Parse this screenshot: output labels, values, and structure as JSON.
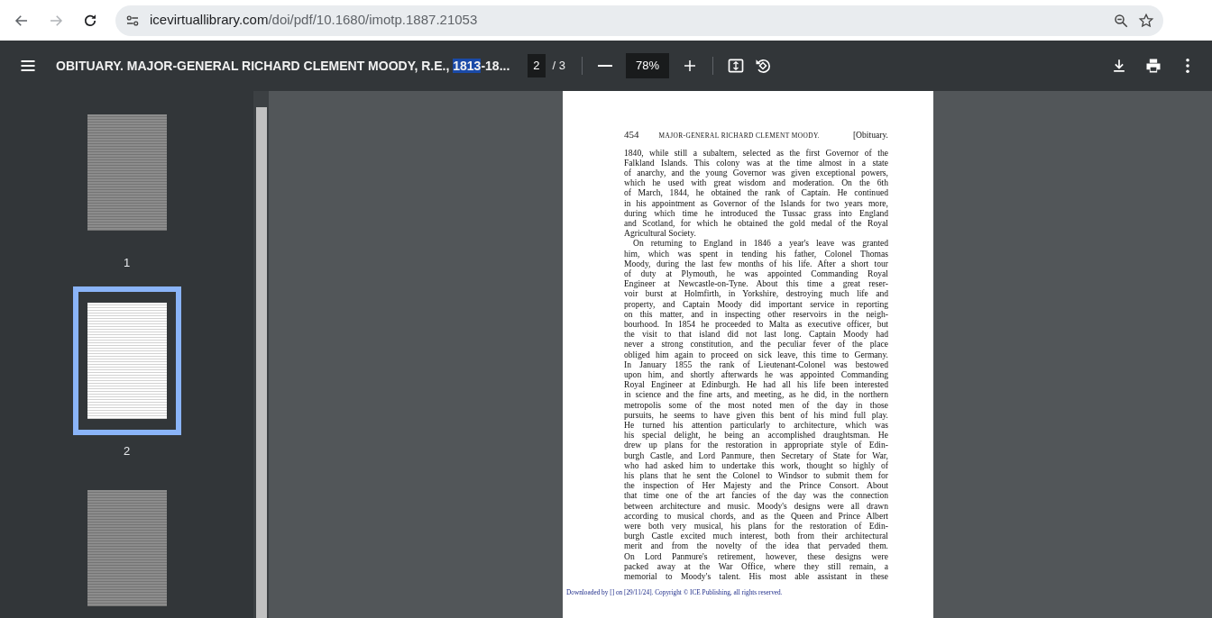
{
  "browser": {
    "back_disabled": false,
    "forward_disabled": true,
    "url_host": "icevirtuallibrary.com",
    "url_path": "/doi/pdf/10.1680/imotp.1887.21053"
  },
  "toolbar": {
    "title_before": "OBITUARY. MAJOR-GENERAL RICHARD CLEMENT MOODY, R.E., ",
    "title_highlight": "1813",
    "title_after": "-18...",
    "page_current": "2",
    "page_total": "/ 3",
    "zoom": "78%"
  },
  "thumbnails": [
    {
      "label": "1",
      "selected": false
    },
    {
      "label": "2",
      "selected": true
    },
    {
      "selected": false
    }
  ],
  "page": {
    "number": "454",
    "running_title": "MAJOR-GENERAL RICHARD CLEMENT MOODY.",
    "section": "[Obituary.",
    "paragraphs": [
      {
        "indent": false,
        "lines": [
          "1840, while still a subaltern, selected as the first Governor of the",
          "Falkland Islands. This colony was at the time almost in a state",
          "of anarchy, and the young Governor was given exceptional powers,",
          "which he used with great wisdom and moderation. On the 6th",
          "of March, 1844, he obtained the rank of Captain. He continued",
          "in his appointment as Governor of the Islands for two years more,",
          "during which time he introduced the Tussac grass into England",
          "and Scotland, for which he obtained the gold medal of the Royal",
          "Agricultural Society."
        ]
      },
      {
        "indent": true,
        "lines": [
          "On returning to England in 1846 a year's leave was granted",
          "him, which was spent in tending his father, Colonel Thomas",
          "Moody, during the last few months of his life. After a short tour",
          "of duty at Plymouth, he was appointed Commanding Royal",
          "Engineer at Newcastle-on-Tyne. About this time a great reser-",
          "voir burst at Holmfirth, in Yorkshire, destroying much life and",
          "property, and Captain Moody did important service in reporting",
          "on this matter, and in inspecting other reservoirs in the neigh-",
          "bourhood. In 1854 he proceeded to Malta as executive officer, but",
          "the visit to that island did not last long. Captain Moody had",
          "never a strong constitution, and the peculiar fever of the place",
          "obliged him again to proceed on sick leave, this time to Germany.",
          "In January 1855 the rank of Lieutenant-Colonel was bestowed",
          "upon him, and shortly afterwards he was appointed Commanding",
          "Royal Engineer at Edinburgh. He had all his life been interested",
          "in science and the fine arts, and meeting, as he did, in the northern",
          "metropolis some of the most noted men of the day in those",
          "pursuits, he seems to have given this bent of his mind full play.",
          "He turned his attention particularly to architecture, which was",
          "his special delight, he being an accomplished draughtsman. He",
          "drew up plans for the restoration in appropriate style of Edin-",
          "burgh Castle, and Lord Panmure, then Secretary of State for War,",
          "who had asked him to undertake this work, thought so highly of",
          "his plans that he sent the Colonel to Windsor to submit them for",
          "the inspection of Her Majesty and the Prince Consort. About",
          "that time one of the art fancies of the day was the connection",
          "between architecture and music. Moody's designs were all drawn",
          "according to musical chords, and as the Queen and Prince Albert",
          "were both very musical, his plans for the restoration of Edin-",
          "burgh Castle excited much interest, both from their architectural",
          "merit and from the novelty of the idea that pervaded them.",
          "On Lord Panmure's retirement, however, these designs were",
          "packed away at the War Office, where they still remain, a",
          "memorial to Moody's talent. His most able assistant in these"
        ]
      }
    ],
    "footer": "Downloaded by [] on [29/11/24]. Copyright © ICE Publishing, all rights reserved."
  }
}
